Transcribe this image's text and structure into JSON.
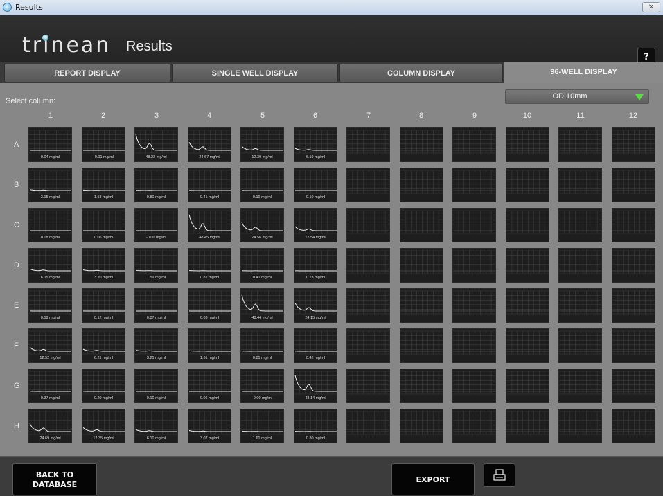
{
  "window": {
    "title": "Results",
    "close_glyph": "✕"
  },
  "header": {
    "logo": "trinean",
    "title": "Results",
    "help": "?"
  },
  "tabs": [
    {
      "label": "REPORT DISPLAY",
      "active": false
    },
    {
      "label": "SINGLE WELL DISPLAY",
      "active": false
    },
    {
      "label": "COLUMN DISPLAY",
      "active": false
    },
    {
      "label": "96-WELL DISPLAY",
      "active": true
    }
  ],
  "main": {
    "select_label": "Select column:",
    "mode": "OD 10mm"
  },
  "columns": [
    "1",
    "2",
    "3",
    "4",
    "5",
    "6",
    "7",
    "8",
    "9",
    "10",
    "11",
    "12"
  ],
  "rows": [
    "A",
    "B",
    "C",
    "D",
    "E",
    "F",
    "G",
    "H"
  ],
  "wells": [
    [
      "0.04 mg/ml",
      "-0.01 mg/ml",
      "48.22 mg/ml",
      "24.67 mg/ml",
      "12.39 mg/ml",
      "6.19 mg/ml",
      "",
      "",
      "",
      "",
      "",
      ""
    ],
    [
      "3.15 mg/ml",
      "1.58 mg/ml",
      "0.80 mg/ml",
      "0.41 mg/ml",
      "0.19 mg/ml",
      "0.10 mg/ml",
      "",
      "",
      "",
      "",
      "",
      ""
    ],
    [
      "0.08 mg/ml",
      "0.06 mg/ml",
      "-0.00 mg/ml",
      "48.45 mg/ml",
      "24.56 mg/ml",
      "12.54 mg/ml",
      "",
      "",
      "",
      "",
      "",
      ""
    ],
    [
      "6.15 mg/ml",
      "3.20 mg/ml",
      "1.59 mg/ml",
      "0.82 mg/ml",
      "0.41 mg/ml",
      "0.23 mg/ml",
      "",
      "",
      "",
      "",
      "",
      ""
    ],
    [
      "0.19 mg/ml",
      "0.12 mg/ml",
      "0.07 mg/ml",
      "0.03 mg/ml",
      "48.44 mg/ml",
      "24.15 mg/ml",
      "",
      "",
      "",
      "",
      "",
      ""
    ],
    [
      "12.52 mg/ml",
      "6.21 mg/ml",
      "3.21 mg/ml",
      "1.61 mg/ml",
      "0.81 mg/ml",
      "0.42 mg/ml",
      "",
      "",
      "",
      "",
      "",
      ""
    ],
    [
      "0.37 mg/ml",
      "0.20 mg/ml",
      "0.10 mg/ml",
      "0.06 mg/ml",
      "-0.00 mg/ml",
      "48.14 mg/ml",
      "",
      "",
      "",
      "",
      "",
      ""
    ],
    [
      "24.69 mg/ml",
      "12.35 mg/ml",
      "6.10 mg/ml",
      "3.07 mg/ml",
      "1.61 mg/ml",
      "0.80 mg/ml",
      "",
      "",
      "",
      "",
      "",
      ""
    ]
  ],
  "buttons": {
    "back_line1": "BACK TO",
    "back_line2": "DATABASE",
    "export": "EXPORT"
  },
  "icons": {
    "print": "printer-icon",
    "close": "close-icon",
    "dropdown": "dropdown-arrow-icon"
  },
  "colors": {
    "active_tab": "#8a8a8a",
    "panel": "#878787",
    "well_bg": "#1e1e1e",
    "dropdown_arrow": "#55e040"
  }
}
